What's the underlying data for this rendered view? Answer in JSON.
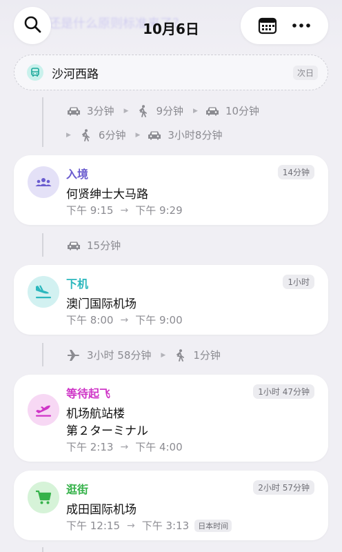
{
  "header": {
    "ghost_text": "还是什么原则标准来了？",
    "date": "10月6日",
    "icons": {
      "search": "search-icon",
      "calendar": "calendar-icon",
      "more": "more-dots-icon"
    }
  },
  "station": {
    "name": "沙河西路",
    "badge": "次日",
    "icon": "bus-icon"
  },
  "segments_1": {
    "row1": [
      "3分钟",
      "9分钟",
      "10分钟"
    ],
    "row2": [
      "6分钟",
      "3小时8分钟"
    ]
  },
  "cards": [
    {
      "type": "入境",
      "type_color": "#6a5ccf",
      "icon_bg": "#e4e1f7",
      "icon": "people-group-icon",
      "duration": "14分钟",
      "place": "何贤绅士大马路",
      "start": "下午 9:15",
      "end": "下午 9:29"
    },
    {
      "type": "下机",
      "type_color": "#2bb7bd",
      "icon_bg": "#d2f1f1",
      "icon": "plane-landing-icon",
      "duration": "1小时",
      "place": "澳门国际机场",
      "start": "下午 8:00",
      "end": "下午 9:00"
    },
    {
      "type": "等待起飞",
      "type_color": "#cf35c7",
      "icon_bg": "#f7d8f4",
      "icon": "plane-takeoff-icon",
      "duration": "1小时 47分钟",
      "place": "机场航站楼",
      "place2": "第２ターミナル",
      "start": "下午 2:13",
      "end": "下午 4:00"
    },
    {
      "type": "逛街",
      "type_color": "#36b24a",
      "icon_bg": "#d6f3d8",
      "icon": "shopping-cart-icon",
      "duration": "2小时 57分钟",
      "place": "成田国际机场",
      "start": "下午 12:15",
      "end": "下午 3:13",
      "tz": "日本时间"
    }
  ],
  "segments_2": {
    "car": "15分钟"
  },
  "segments_3": {
    "flight": "3小时 58分钟",
    "walk": "1分钟"
  },
  "arrow": "→"
}
